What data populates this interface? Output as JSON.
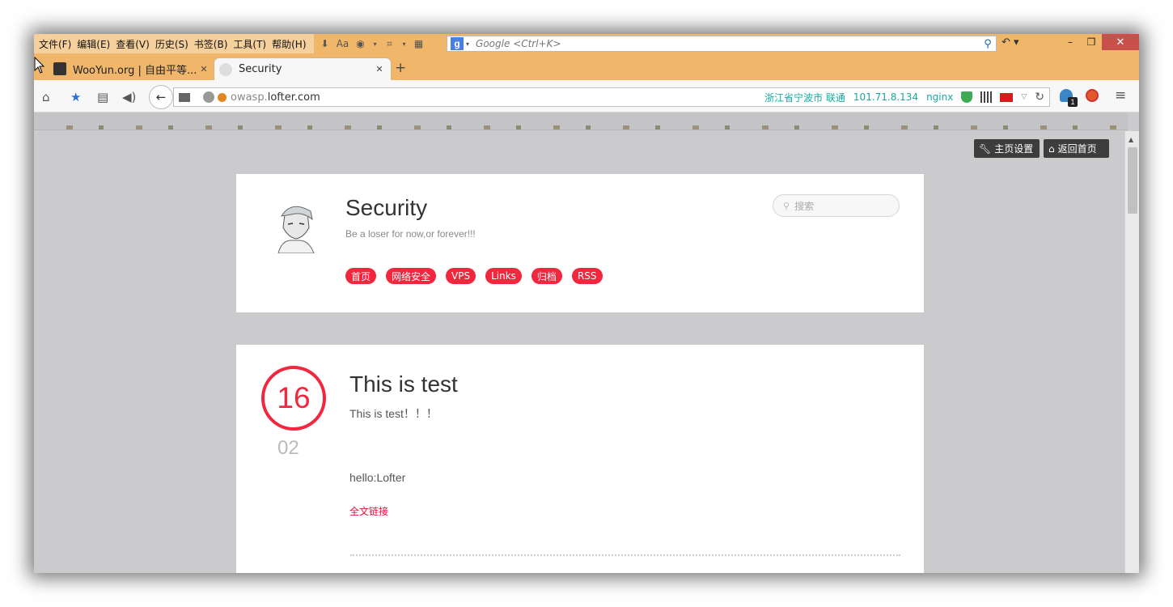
{
  "menubar": {
    "menus": [
      "文件(F)",
      "编辑(E)",
      "查看(V)",
      "历史(S)",
      "书签(B)",
      "工具(T)",
      "帮助(H)"
    ],
    "search_placeholder": "Google <Ctrl+K>",
    "search_engine": "g-icon"
  },
  "tabs": [
    {
      "title": "WooYun.org | 自由平等...",
      "active": false
    },
    {
      "title": "Security",
      "active": true
    }
  ],
  "navbar": {
    "url_prefix": "owasp.",
    "url_domain": "lofter.com",
    "location": "浙江省宁波市 联通",
    "ip": "101.71.8.134",
    "server": "nginx",
    "ghost_badge": "1"
  },
  "page": {
    "top_buttons": {
      "settings": "主页设置",
      "home": "返回首页"
    },
    "blog": {
      "title": "Security",
      "subtitle": "Be a loser for now,or forever!!!",
      "search_placeholder": "搜索",
      "nav": [
        "首页",
        "网络安全",
        "VPS",
        "Links",
        "归档",
        "RSS"
      ]
    },
    "post": {
      "day": "16",
      "month": "02",
      "title": "This is test",
      "subtitle": "This is test！！！",
      "body": "hello:Lofter",
      "link": "全文链接"
    }
  },
  "colors": {
    "accent": "#f2273e",
    "chrome": "#f0b66a",
    "page_bg": "#cbcbcd"
  }
}
